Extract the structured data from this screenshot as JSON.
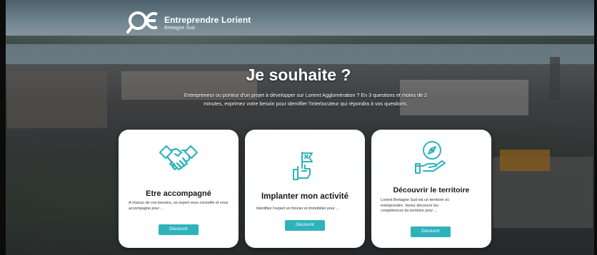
{
  "brand": {
    "name": "Entreprendre Lorient",
    "subtitle": "Bretagne Sud"
  },
  "hero": {
    "title": "Je souhaite ?",
    "description": "Entrepreneur ou porteur d'un projet à développer sur Lorient Agglomération ? En 3 questions et moins de 2 minutes, exprimez votre besoin pour identifier l'interlocuteur qui répondra à vos questions."
  },
  "cards": [
    {
      "icon": "handshake-icon",
      "title": "Etre accompagné",
      "description": "A chacun de vos besoins, un expert vous conseille et vous accompagne pour ...",
      "button": "Découvrir"
    },
    {
      "icon": "flag-hand-icon",
      "title": "Implanter mon activité",
      "description": "Identifiez l'expert en foncier et immobilier pour ...",
      "button": "Découvrir"
    },
    {
      "icon": "compass-hand-icon",
      "title": "Découvrir le territoire",
      "description": "Lorient Bretagne Sud est un territoire où entreprendre. Venez découvrir les compétences du territoire pour ...",
      "button": "Découvrir"
    }
  ],
  "colors": {
    "accent": "#2fb3bb",
    "card_background": "#ffffff",
    "title_text": "#1a1a1a"
  }
}
